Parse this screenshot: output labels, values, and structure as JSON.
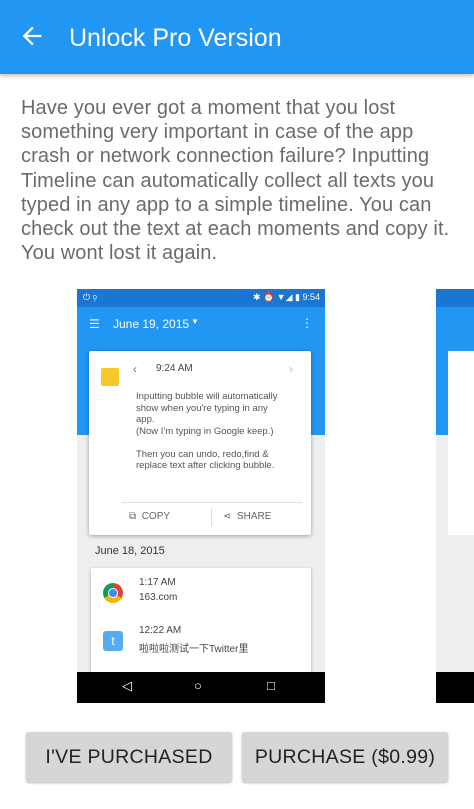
{
  "header": {
    "title": "Unlock Pro Version",
    "back_icon": "arrow-back-icon",
    "color": "#2196f3"
  },
  "description": "Have you ever got a moment that you lost something very important in case of the app crash or network connection failure? Inputting Timeline can automatically collect all texts you typed in any app to a simple timeline. You can check out the text at each moments and copy it. You wont lost it again.",
  "screenshot": {
    "status_time": "9:54",
    "toolbar_date": "June 19, 2015",
    "card": {
      "time": "9:24 AM",
      "message_lines": [
        "Inputting bubble will automatically",
        "show when you're typing in any",
        "app.",
        "(Now I'm typing in Google keep.)",
        "",
        "Then you can undo, redo,find &",
        "replace text after clicking bubble."
      ],
      "copy_label": "COPY",
      "share_label": "SHARE"
    },
    "section_date": "June 18, 2015",
    "entries": [
      {
        "time": "1:17 AM",
        "text": "163.com",
        "icon": "chrome-icon"
      },
      {
        "time": "12:22 AM",
        "text": "啦啦啦测试一下Twitter里",
        "icon": "twitter-icon"
      }
    ]
  },
  "buttons": {
    "purchased": "I'VE PURCHASED",
    "purchase": "PURCHASE ($0.99)"
  }
}
